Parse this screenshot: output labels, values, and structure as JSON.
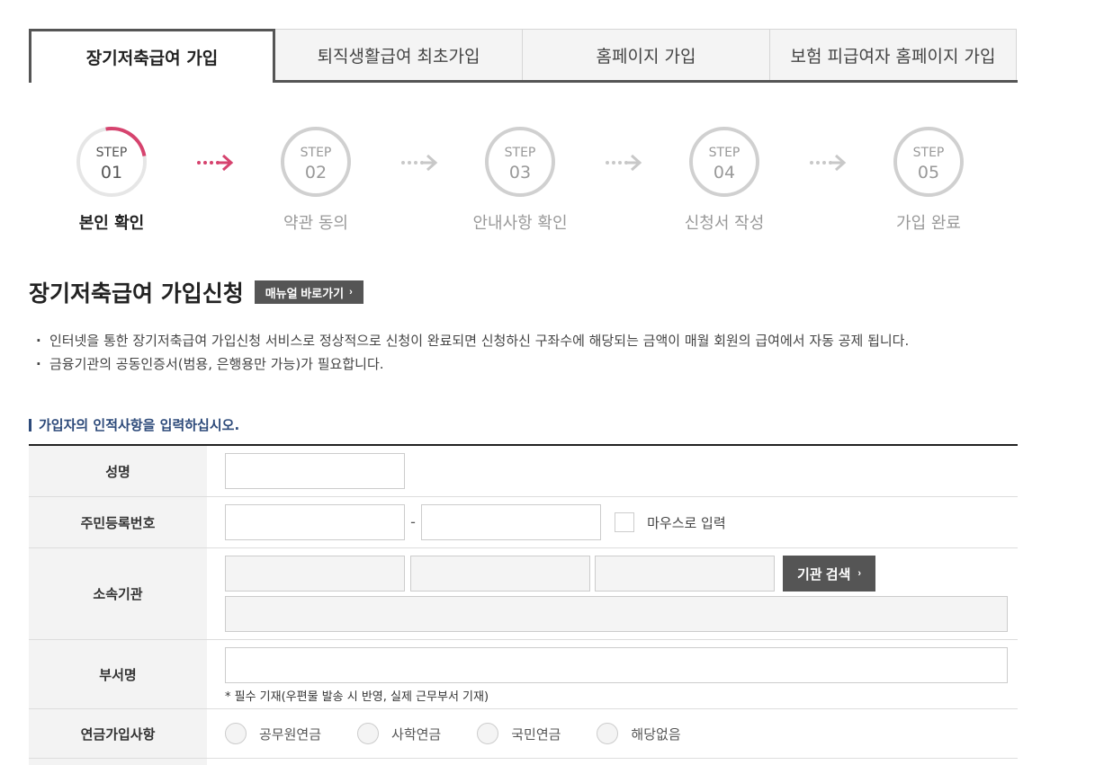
{
  "tabs": [
    {
      "label": "장기저축급여 가입",
      "active": true
    },
    {
      "label": "퇴직생활급여 최초가입",
      "active": false
    },
    {
      "label": "홈페이지 가입",
      "active": false
    },
    {
      "label": "보험 피급여자 홈페이지 가입",
      "active": false
    }
  ],
  "steps": [
    {
      "label": "STEP",
      "number": "01",
      "name": "본인 확인",
      "active": true
    },
    {
      "label": "STEP",
      "number": "02",
      "name": "약관 동의",
      "active": false
    },
    {
      "label": "STEP",
      "number": "03",
      "name": "안내사항 확인",
      "active": false
    },
    {
      "label": "STEP",
      "number": "04",
      "name": "신청서 작성",
      "active": false
    },
    {
      "label": "STEP",
      "number": "05",
      "name": "가입 완료",
      "active": false
    }
  ],
  "colors": {
    "accent": "#d6436e",
    "inactive": "#c8c8c8",
    "dark_button": "#555555",
    "section_heading": "#2d4a7a"
  },
  "title": "장기저축급여 가입신청",
  "manual_button": {
    "label": "매뉴얼 바로가기",
    "icon": "chevron-right-icon"
  },
  "notices": [
    "인터넷을 통한 장기저축급여 가입신청 서비스로 정상적으로 신청이 완료되면 신청하신 구좌수에 해당되는 금액이 매월 회원의 급여에서 자동 공제 됩니다.",
    "금융기관의 공동인증서(범용, 은행용만 가능)가 필요합니다."
  ],
  "section_heading": "가입자의 인적사항을 입력하십시오.",
  "form": {
    "name_label": "성명",
    "rrn_label": "주민등록번호",
    "rrn_separator": "-",
    "mouse_input_label": "마우스로 입력",
    "org_label": "소속기관",
    "org_search_button": "기관 검색",
    "dept_label": "부서명",
    "dept_note": "* 필수 기재(우편물 발송 시 반영, 실제 근무부서 기재)",
    "pension_label": "연금가입사항",
    "pension_options": [
      "공무원연금",
      "사학연금",
      "국민연금",
      "해당없음"
    ]
  }
}
